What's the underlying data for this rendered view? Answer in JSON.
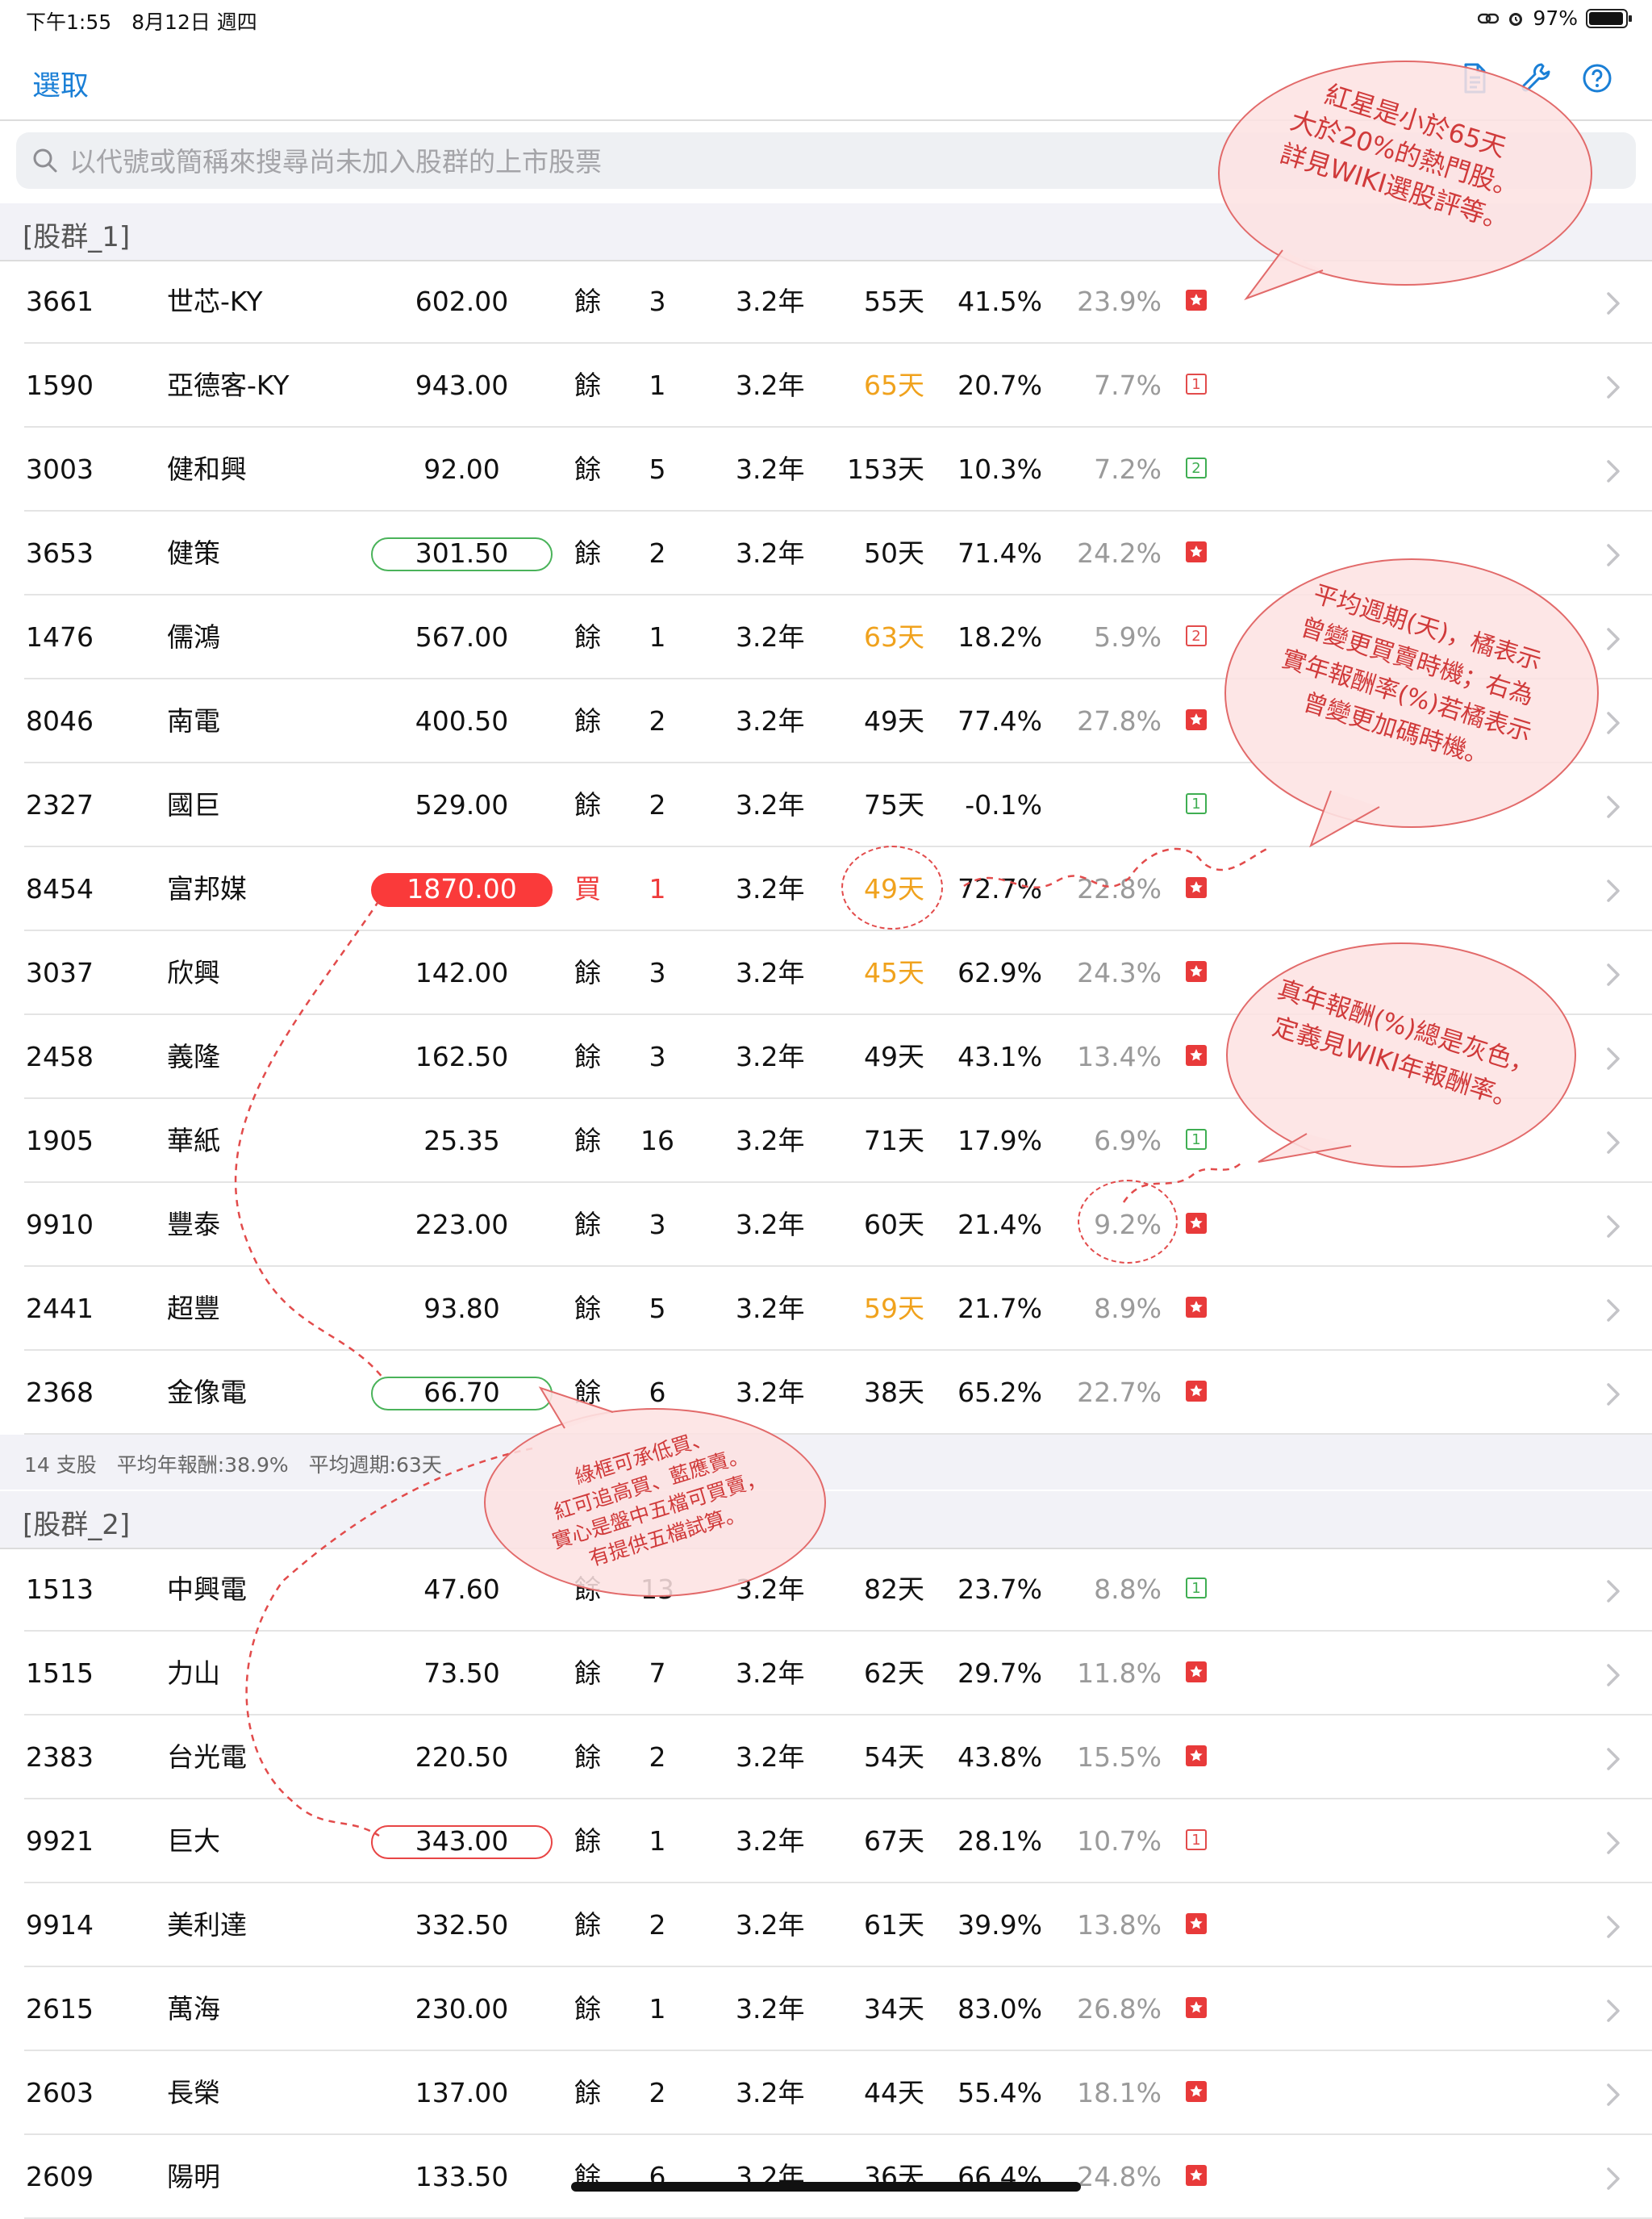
{
  "status": {
    "time": "下午1:55　8月12日 週四",
    "battery": "97%"
  },
  "nav": {
    "select_label": "選取"
  },
  "search": {
    "placeholder": "以代號或簡稱來搜尋尚未加入股群的上市股票"
  },
  "groups": [
    {
      "title": "[股群_1]",
      "rows": [
        {
          "code": "3661",
          "name": "世芯-KY",
          "price": "602.00",
          "action": "餘",
          "count": "3",
          "years": "3.2年",
          "days": "55天",
          "ret": "41.5%",
          "real": "23.9%",
          "badge": "star"
        },
        {
          "code": "1590",
          "name": "亞德客-KY",
          "price": "943.00",
          "action": "餘",
          "count": "1",
          "years": "3.2年",
          "days": "65天",
          "ret": "20.7%",
          "real": "7.7%",
          "badge": "1"
        },
        {
          "code": "3003",
          "name": "健和興",
          "price": "92.00",
          "action": "餘",
          "count": "5",
          "years": "3.2年",
          "days": "153天",
          "ret": "10.3%",
          "real": "7.2%",
          "badge": "2"
        },
        {
          "code": "3653",
          "name": "健策",
          "price": "301.50",
          "action": "餘",
          "count": "2",
          "years": "3.2年",
          "days": "50天",
          "ret": "71.4%",
          "real": "24.2%",
          "badge": "star"
        },
        {
          "code": "1476",
          "name": "儒鴻",
          "price": "567.00",
          "action": "餘",
          "count": "1",
          "years": "3.2年",
          "days": "63天",
          "ret": "18.2%",
          "real": "5.9%",
          "badge": "2"
        },
        {
          "code": "8046",
          "name": "南電",
          "price": "400.50",
          "action": "餘",
          "count": "2",
          "years": "3.2年",
          "days": "49天",
          "ret": "77.4%",
          "real": "27.8%",
          "badge": "star"
        },
        {
          "code": "2327",
          "name": "國巨",
          "price": "529.00",
          "action": "餘",
          "count": "2",
          "years": "3.2年",
          "days": "75天",
          "ret": "-0.1%",
          "real": "",
          "badge": "1"
        },
        {
          "code": "8454",
          "name": "富邦媒",
          "price": "1870.00",
          "action": "買",
          "count": "1",
          "years": "3.2年",
          "days": "49天",
          "ret": "72.7%",
          "real": "22.8%",
          "badge": "star"
        },
        {
          "code": "3037",
          "name": "欣興",
          "price": "142.00",
          "action": "餘",
          "count": "3",
          "years": "3.2年",
          "days": "45天",
          "ret": "62.9%",
          "real": "24.3%",
          "badge": "star"
        },
        {
          "code": "2458",
          "name": "義隆",
          "price": "162.50",
          "action": "餘",
          "count": "3",
          "years": "3.2年",
          "days": "49天",
          "ret": "43.1%",
          "real": "13.4%",
          "badge": "star"
        },
        {
          "code": "1905",
          "name": "華紙",
          "price": "25.35",
          "action": "餘",
          "count": "16",
          "years": "3.2年",
          "days": "71天",
          "ret": "17.9%",
          "real": "6.9%",
          "badge": "1"
        },
        {
          "code": "9910",
          "name": "豐泰",
          "price": "223.00",
          "action": "餘",
          "count": "3",
          "years": "3.2年",
          "days": "60天",
          "ret": "21.4%",
          "real": "9.2%",
          "badge": "star"
        },
        {
          "code": "2441",
          "name": "超豐",
          "price": "93.80",
          "action": "餘",
          "count": "5",
          "years": "3.2年",
          "days": "59天",
          "ret": "21.7%",
          "real": "8.9%",
          "badge": "star"
        },
        {
          "code": "2368",
          "name": "金像電",
          "price": "66.70",
          "action": "餘",
          "count": "6",
          "years": "3.2年",
          "days": "38天",
          "ret": "65.2%",
          "real": "22.7%",
          "badge": "star"
        }
      ],
      "summary": "14 支股　平均年報酬:38.9%　平均週期:63天"
    },
    {
      "title": "[股群_2]",
      "rows": [
        {
          "code": "1513",
          "name": "中興電",
          "price": "47.60",
          "action": "餘",
          "count": "13",
          "years": "3.2年",
          "days": "82天",
          "ret": "23.7%",
          "real": "8.8%",
          "badge": "1"
        },
        {
          "code": "1515",
          "name": "力山",
          "price": "73.50",
          "action": "餘",
          "count": "7",
          "years": "3.2年",
          "days": "62天",
          "ret": "29.7%",
          "real": "11.8%",
          "badge": "star"
        },
        {
          "code": "2383",
          "name": "台光電",
          "price": "220.50",
          "action": "餘",
          "count": "2",
          "years": "3.2年",
          "days": "54天",
          "ret": "43.8%",
          "real": "15.5%",
          "badge": "star"
        },
        {
          "code": "9921",
          "name": "巨大",
          "price": "343.00",
          "action": "餘",
          "count": "1",
          "years": "3.2年",
          "days": "67天",
          "ret": "28.1%",
          "real": "10.7%",
          "badge": "1"
        },
        {
          "code": "9914",
          "name": "美利達",
          "price": "332.50",
          "action": "餘",
          "count": "2",
          "years": "3.2年",
          "days": "61天",
          "ret": "39.9%",
          "real": "13.8%",
          "badge": "star"
        },
        {
          "code": "2615",
          "name": "萬海",
          "price": "230.00",
          "action": "餘",
          "count": "1",
          "years": "3.2年",
          "days": "34天",
          "ret": "83.0%",
          "real": "26.8%",
          "badge": "star"
        },
        {
          "code": "2603",
          "name": "長榮",
          "price": "137.00",
          "action": "餘",
          "count": "2",
          "years": "3.2年",
          "days": "44天",
          "ret": "55.4%",
          "real": "18.1%",
          "badge": "star"
        },
        {
          "code": "2609",
          "name": "陽明",
          "price": "133.50",
          "action": "餘",
          "count": "6",
          "years": "3.2年",
          "days": "36天",
          "ret": "66.4%",
          "real": "24.8%",
          "badge": "star"
        }
      ]
    }
  ],
  "annotations": {
    "hot": [
      "紅星是小於65天",
      "大於20%的熱門股。",
      "詳見WIKI選股評等。"
    ],
    "cycle": [
      "平均週期(天)，橘表示",
      "曾變更買賣時機；右為",
      "實年報酬率(%)若橘表示",
      "曾變更加碼時機。"
    ],
    "real": [
      "真年報酬(%)總是灰色，",
      "定義見WIKI年報酬率。"
    ],
    "box": [
      "綠框可承低買、",
      "紅可追高買、藍應賣。",
      "實心是盤中五檔可買賣，",
      "有提供五檔試算。"
    ]
  }
}
